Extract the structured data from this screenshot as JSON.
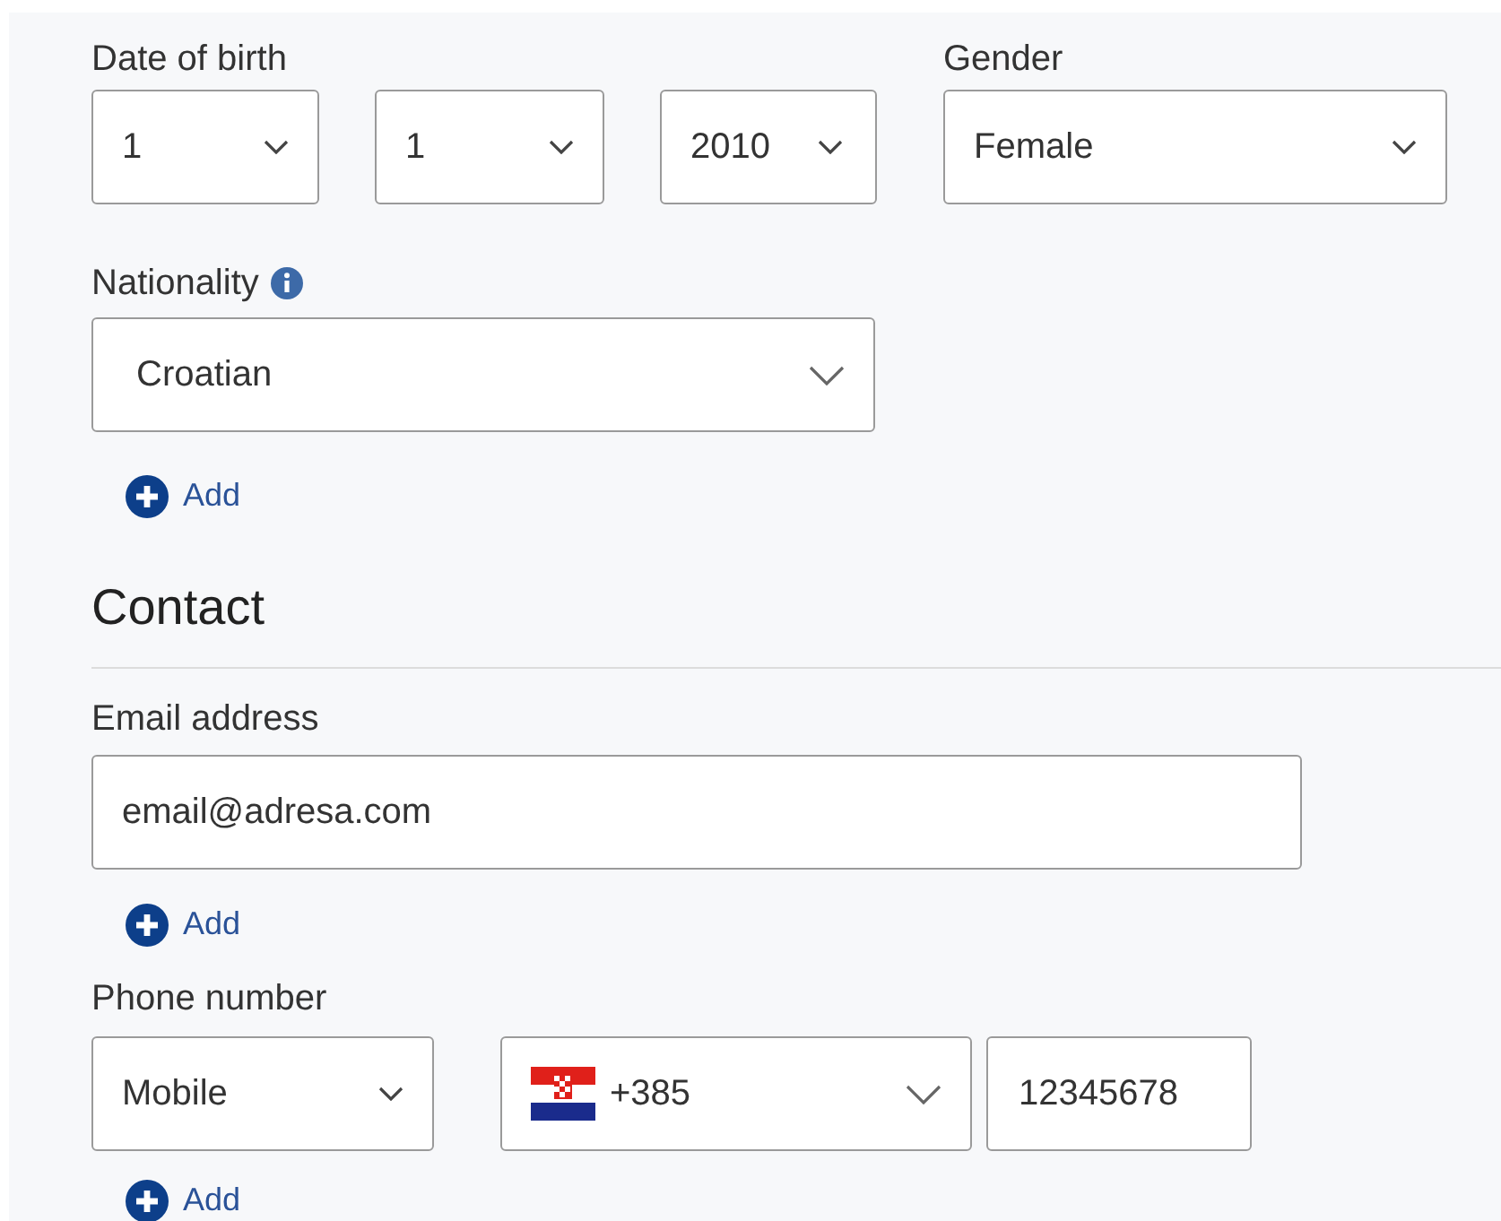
{
  "date_of_birth": {
    "label": "Date of birth",
    "day": "1",
    "month": "1",
    "year": "2010"
  },
  "gender": {
    "label": "Gender",
    "value": "Female"
  },
  "nationality": {
    "label": "Nationality",
    "value": "Croatian",
    "add": "Add"
  },
  "contact": {
    "heading": "Contact",
    "email": {
      "label": "Email address",
      "value": "email@adresa.com",
      "add": "Add"
    },
    "phone": {
      "label": "Phone number",
      "type": "Mobile",
      "country_code": "+385",
      "number": "12345678",
      "add": "Add"
    }
  }
}
